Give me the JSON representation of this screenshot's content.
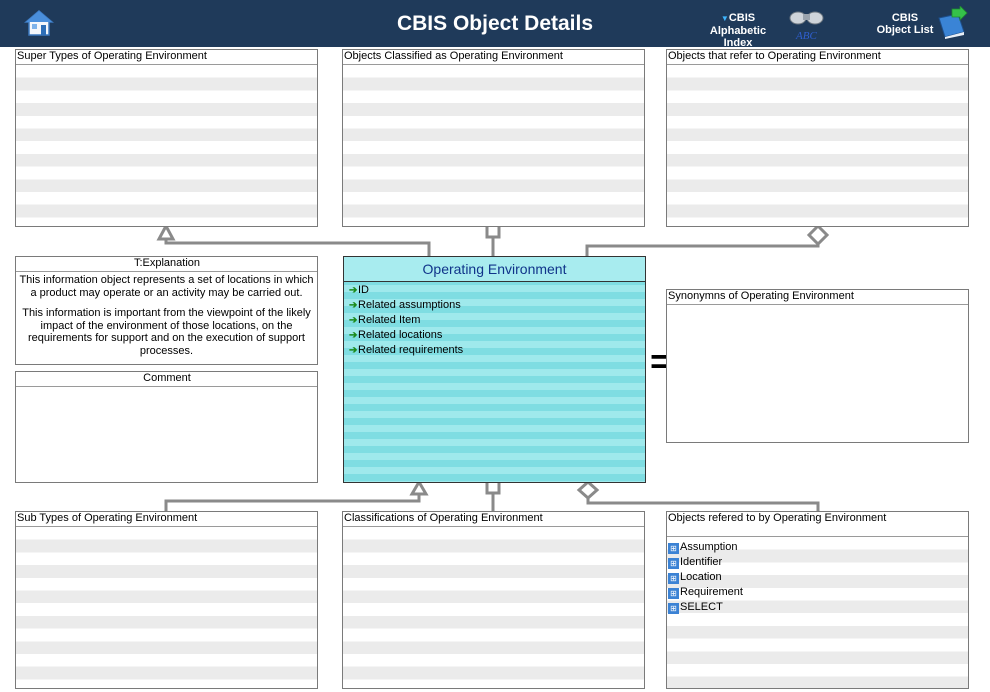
{
  "header": {
    "title": "CBIS Object Details",
    "home_icon": "home-icon",
    "alpha_index_line1": "CBIS Alphabetic",
    "alpha_index_line2": "Index",
    "alpha_index_icon": "binoculars-abc-icon",
    "object_list_line1": "CBIS",
    "object_list_line2": "Object List",
    "object_list_icon": "book-arrow-icon",
    "abc_text": "ABC"
  },
  "panels": {
    "super_types": "Super Types of Operating Environment",
    "classified_as": "Objects Classified as  Operating Environment",
    "refer_to": "Objects that refer to   Operating Environment",
    "explanation_title": "T:Explanation",
    "explanation_p1": "This information object represents a set of locations in which a product may operate or an activity may be carried out.",
    "explanation_p2": "This information is important from the viewpoint of the likely impact of the environment of those locations, on the requirements for support and on the execution of support processes.",
    "comment_title": "Comment",
    "synonyms": "Synonymns   of Operating Environment",
    "sub_types": "Sub Types of Operating Environment",
    "classifications": "Classifications of  Operating Environment",
    "refered_by": "Objects refered to by   Operating Environment"
  },
  "entity": {
    "name": "Operating Environment",
    "attributes": [
      "ID",
      "Related assumptions",
      "Related Item",
      "Related locations",
      "Related requirements"
    ]
  },
  "refered_by_items": [
    "Assumption",
    "Identifier",
    "Location",
    "Requirement",
    "SELECT"
  ],
  "equals_symbol": "="
}
